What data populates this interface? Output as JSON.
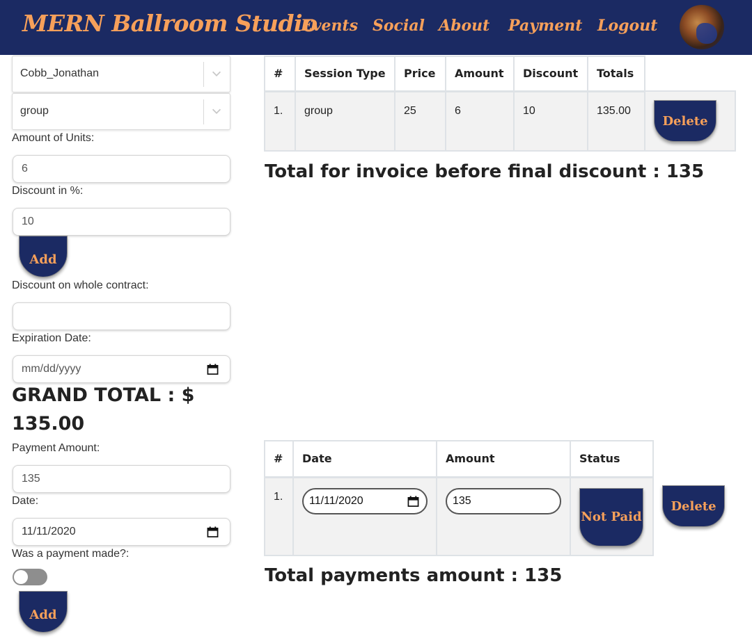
{
  "nav": {
    "brand": "MERN Ballroom Studio",
    "links": [
      "Events",
      "Social",
      "About",
      "Payment",
      "Logout"
    ]
  },
  "form": {
    "student_select": "Cobb_Jonathan",
    "session_select": "group",
    "units_label": "Amount of Units:",
    "units_value": "6",
    "discount_label": "Discount in %:",
    "discount_value": "10",
    "add_label": "Add",
    "contract_discount_label": "Discount on whole contract:",
    "contract_discount_value": "",
    "expiration_label": "Expiration Date:",
    "expiration_placeholder": "mm/dd/yyyy",
    "grand_total": "GRAND TOTAL : $ 135.00",
    "payment_amount_label": "Payment Amount:",
    "payment_amount_value": "135",
    "date_label": "Date:",
    "date_value": "11/11/2020",
    "payment_made_label": "Was a payment made?:",
    "payment_made": false,
    "add2_label": "Add"
  },
  "sessions_table": {
    "headers": [
      "#",
      "Session Type",
      "Price",
      "Amount",
      "Discount",
      "Totals"
    ],
    "rows": [
      {
        "num": "1.",
        "type": "group",
        "price": "25",
        "amount": "6",
        "discount": "10",
        "total": "135.00",
        "action": "Delete"
      }
    ]
  },
  "invoice_total": "Total for invoice before final discount : 135",
  "payments_table": {
    "headers": [
      "#",
      "Date",
      "Amount",
      "Status"
    ],
    "rows": [
      {
        "num": "1.",
        "date": "11/11/2020",
        "amount": "135",
        "status": "Not Paid",
        "action": "Delete"
      }
    ]
  },
  "payments_total": "Total payments amount : 135",
  "colors": {
    "navy": "#1b2a63",
    "accent": "#f7a05a"
  },
  "icons": {
    "chevron": "chevron-down-icon",
    "calendar": "calendar-icon"
  }
}
